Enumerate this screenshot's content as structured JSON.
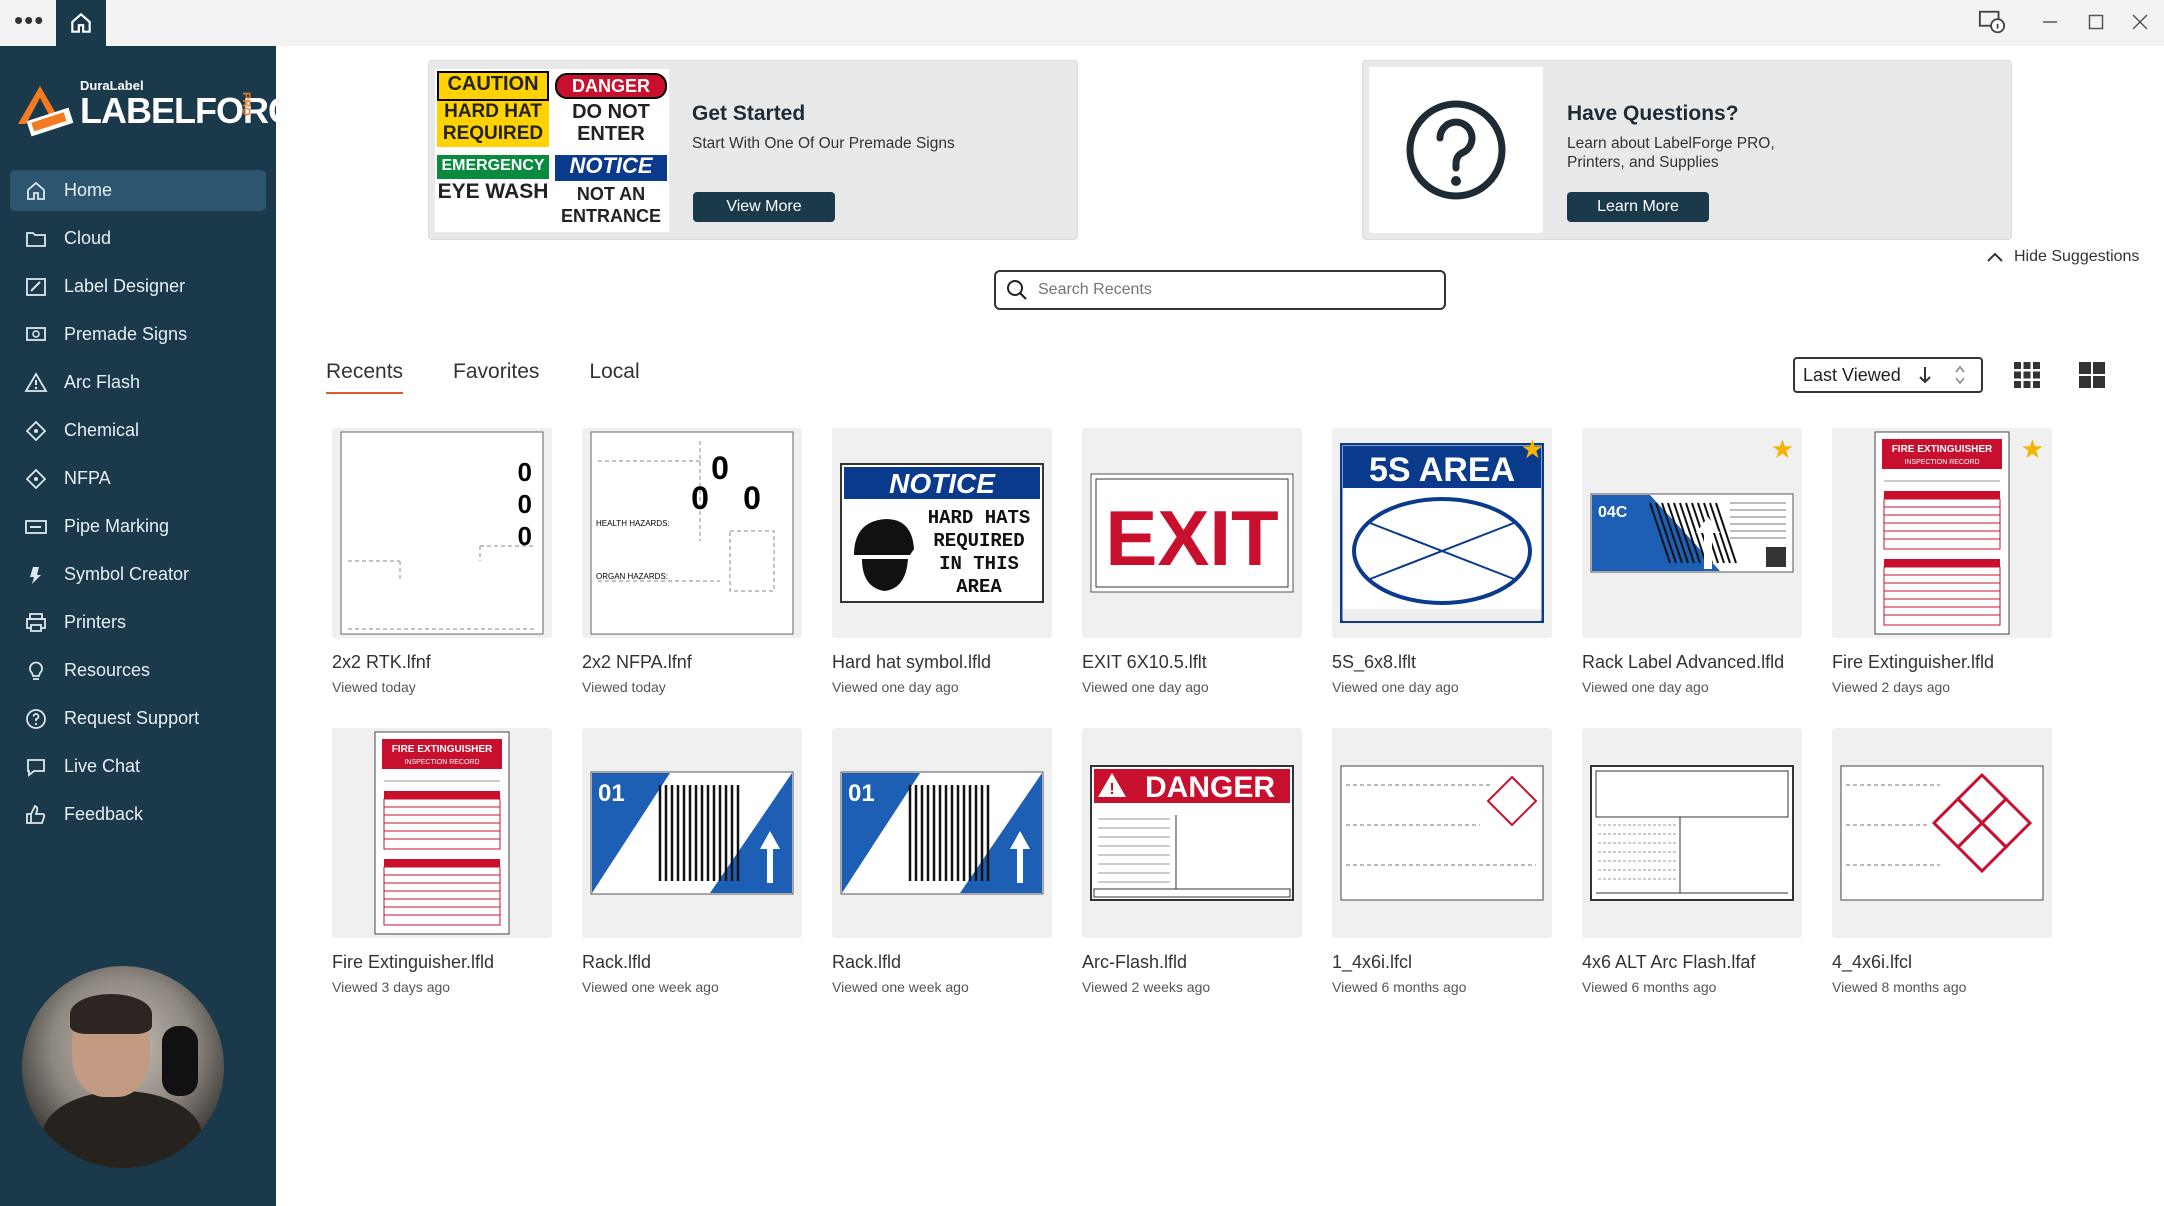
{
  "titlebar": {
    "menu_icon": "more-dots-icon",
    "home_icon": "home-icon"
  },
  "brand": {
    "small": "DuraLabel",
    "name": "LABELFORGE",
    "suffix": "PRO"
  },
  "nav": [
    {
      "label": "Home",
      "icon": "home-icon",
      "active": true
    },
    {
      "label": "Cloud",
      "icon": "cloud-folder-icon"
    },
    {
      "label": "Label Designer",
      "icon": "label-designer-icon"
    },
    {
      "label": "Premade Signs",
      "icon": "premade-signs-icon"
    },
    {
      "label": "Arc Flash",
      "icon": "warning-triangle-icon"
    },
    {
      "label": "Chemical",
      "icon": "diamond-icon"
    },
    {
      "label": "NFPA",
      "icon": "diamond-icon"
    },
    {
      "label": "Pipe Marking",
      "icon": "pipe-marking-icon"
    },
    {
      "label": "Symbol Creator",
      "icon": "symbol-creator-icon"
    },
    {
      "label": "Printers",
      "icon": "printer-icon"
    },
    {
      "label": "Resources",
      "icon": "lightbulb-icon"
    },
    {
      "label": "Request Support",
      "icon": "question-circle-icon"
    },
    {
      "label": "Live Chat",
      "icon": "chat-bubble-icon"
    },
    {
      "label": "Feedback",
      "icon": "thumbs-up-icon"
    }
  ],
  "get_started": {
    "title": "Get Started",
    "text": "Start With One Of Our Premade Signs",
    "button": "View More",
    "signs": {
      "caution_head": "CAUTION",
      "caution_body": "HARD HAT REQUIRED",
      "danger_head": "DANGER",
      "danger_body": "DO NOT ENTER",
      "emergency_head": "EMERGENCY",
      "emergency_body": "EYE WASH",
      "notice_head": "NOTICE",
      "notice_body": "NOT AN ENTRANCE"
    }
  },
  "questions": {
    "title": "Have Questions?",
    "text": "Learn about LabelForge PRO, Printers, and Supplies",
    "button": "Learn More"
  },
  "hide_suggestions": "Hide Suggestions",
  "search": {
    "placeholder": "Search Recents"
  },
  "tabs": [
    "Recents",
    "Favorites",
    "Local"
  ],
  "sort": {
    "label": "Last Viewed"
  },
  "files": [
    {
      "name": "2x2 RTK.lfnf",
      "viewed": "Viewed today",
      "kind": "rtk",
      "fav": false
    },
    {
      "name": "2x2 NFPA.lfnf",
      "viewed": "Viewed today",
      "kind": "nfpa",
      "fav": false
    },
    {
      "name": "Hard hat symbol.lfld",
      "viewed": "Viewed one day ago",
      "kind": "notice",
      "fav": false
    },
    {
      "name": "EXIT 6X10.5.lflt",
      "viewed": "Viewed one day ago",
      "kind": "exit",
      "fav": false
    },
    {
      "name": "5S_6x8.lflt",
      "viewed": "Viewed one day ago",
      "kind": "5s",
      "fav": true
    },
    {
      "name": "Rack Label Advanced.lfld",
      "viewed": "Viewed one day ago",
      "kind": "rackadv",
      "fav": true
    },
    {
      "name": "Fire Extinguisher.lfld",
      "viewed": "Viewed 2 days ago",
      "kind": "fire",
      "fav": true
    },
    {
      "name": "Fire Extinguisher.lfld",
      "viewed": "Viewed 3 days ago",
      "kind": "fire",
      "fav": false
    },
    {
      "name": "Rack.lfld",
      "viewed": "Viewed one week ago",
      "kind": "rack",
      "fav": false
    },
    {
      "name": "Rack.lfld",
      "viewed": "Viewed one week ago",
      "kind": "rack",
      "fav": false
    },
    {
      "name": "Arc-Flash.lfld",
      "viewed": "Viewed 2 weeks ago",
      "kind": "arc",
      "fav": false
    },
    {
      "name": "1_4x6i.lfcl",
      "viewed": "Viewed 6 months ago",
      "kind": "chem1",
      "fav": false
    },
    {
      "name": "4x6 ALT Arc Flash.lfaf",
      "viewed": "Viewed 6 months ago",
      "kind": "altarc",
      "fav": false
    },
    {
      "name": "4_4x6i.lfcl",
      "viewed": "Viewed 8 months ago",
      "kind": "chem4",
      "fav": false
    }
  ],
  "thumb_text": {
    "rtk_digits": [
      "0",
      "0",
      "0"
    ],
    "nfpa_digits": [
      "0",
      "0",
      "0"
    ],
    "nfpa_health": "HEALTH HAZARDS:",
    "nfpa_organ": "ORGAN HAZARDS:",
    "notice_head": "NOTICE",
    "notice_body": "HARD HATS REQUIRED IN THIS AREA",
    "exit": "EXIT",
    "five_s": "5S AREA",
    "rack_adv_code": "04C",
    "rack_code": "01",
    "fire_title": "FIRE EXTINGUISHER",
    "fire_sub": "INSPECTION RECORD",
    "danger": "DANGER"
  },
  "colors": {
    "sidebar": "#1a3a4c",
    "accent": "#e05a2a",
    "star": "#f5b400",
    "rack_blue": "#1d5fb5",
    "danger_red": "#c8102e"
  }
}
